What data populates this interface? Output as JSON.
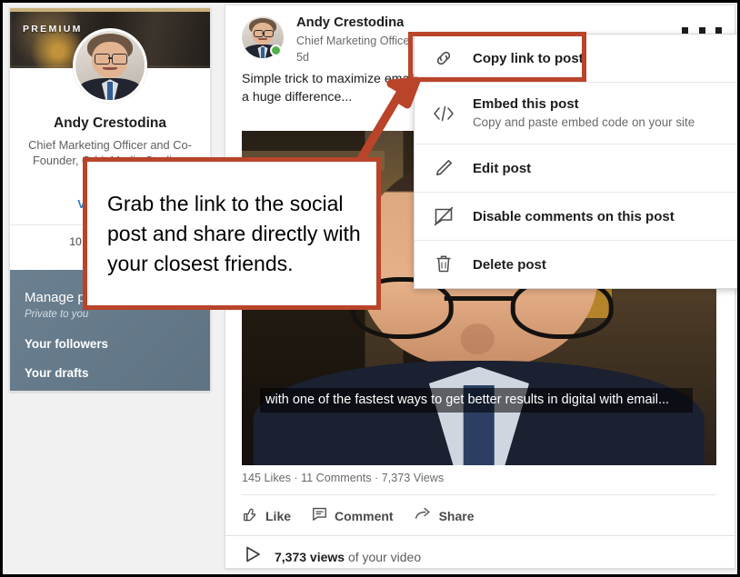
{
  "sidebar": {
    "premium_badge": "PREMIUM",
    "name": "Andy Crestodina",
    "title": "Chief Marketing Officer and Co-Founder, Orbit Media Studios, Inc.",
    "view_link": "View profile",
    "stats": "10,000 followers",
    "manage": {
      "title": "Manage posts",
      "subtitle": "Private to you",
      "links": [
        {
          "label": "Your followers"
        },
        {
          "label": "Your drafts"
        }
      ]
    }
  },
  "post": {
    "author": "Andy Crestodina",
    "subtitle": "Chief Marketing Officer and Co-Founder, Orbit Media Studios, Inc.",
    "time": "5d",
    "menu_icon": "overflow-dots-icon",
    "body": "Simple trick to maximize email engagement. This is one of those tactics that makes a huge difference...",
    "video_caption": "with one of the fastest ways to get better results in digital with email...",
    "stats_line": "145 Likes · 11 Comments · 7,373 Views",
    "actions": [
      {
        "icon": "thumbs-up-icon",
        "label": "Like"
      },
      {
        "icon": "comment-bubble-icon",
        "label": "Comment"
      },
      {
        "icon": "share-arrow-icon",
        "label": "Share"
      }
    ],
    "views": {
      "icon": "play-triangle-icon",
      "count": "7,373 views",
      "suffix": " of your video"
    }
  },
  "menu": {
    "items": [
      {
        "icon": "link-chain-icon",
        "label": "Copy link to post",
        "desc": ""
      },
      {
        "icon": "embed-code-icon",
        "label": "Embed this post",
        "desc": "Copy and paste embed code on your site"
      },
      {
        "icon": "pencil-icon",
        "label": "Edit post",
        "desc": ""
      },
      {
        "icon": "disable-comments-icon",
        "label": "Disable comments on this post",
        "desc": ""
      },
      {
        "icon": "trash-icon",
        "label": "Delete post",
        "desc": ""
      }
    ]
  },
  "annotation": {
    "text": "Grab the link to the social post and share directly with your closest friends.",
    "color": "#b9442a"
  },
  "colors": {
    "annotation_red": "#b9442a",
    "manage_panel": "#63798a",
    "link_blue": "#2a79c6",
    "presence_green": "#52b14d",
    "page_background": "#f1f1f1"
  }
}
